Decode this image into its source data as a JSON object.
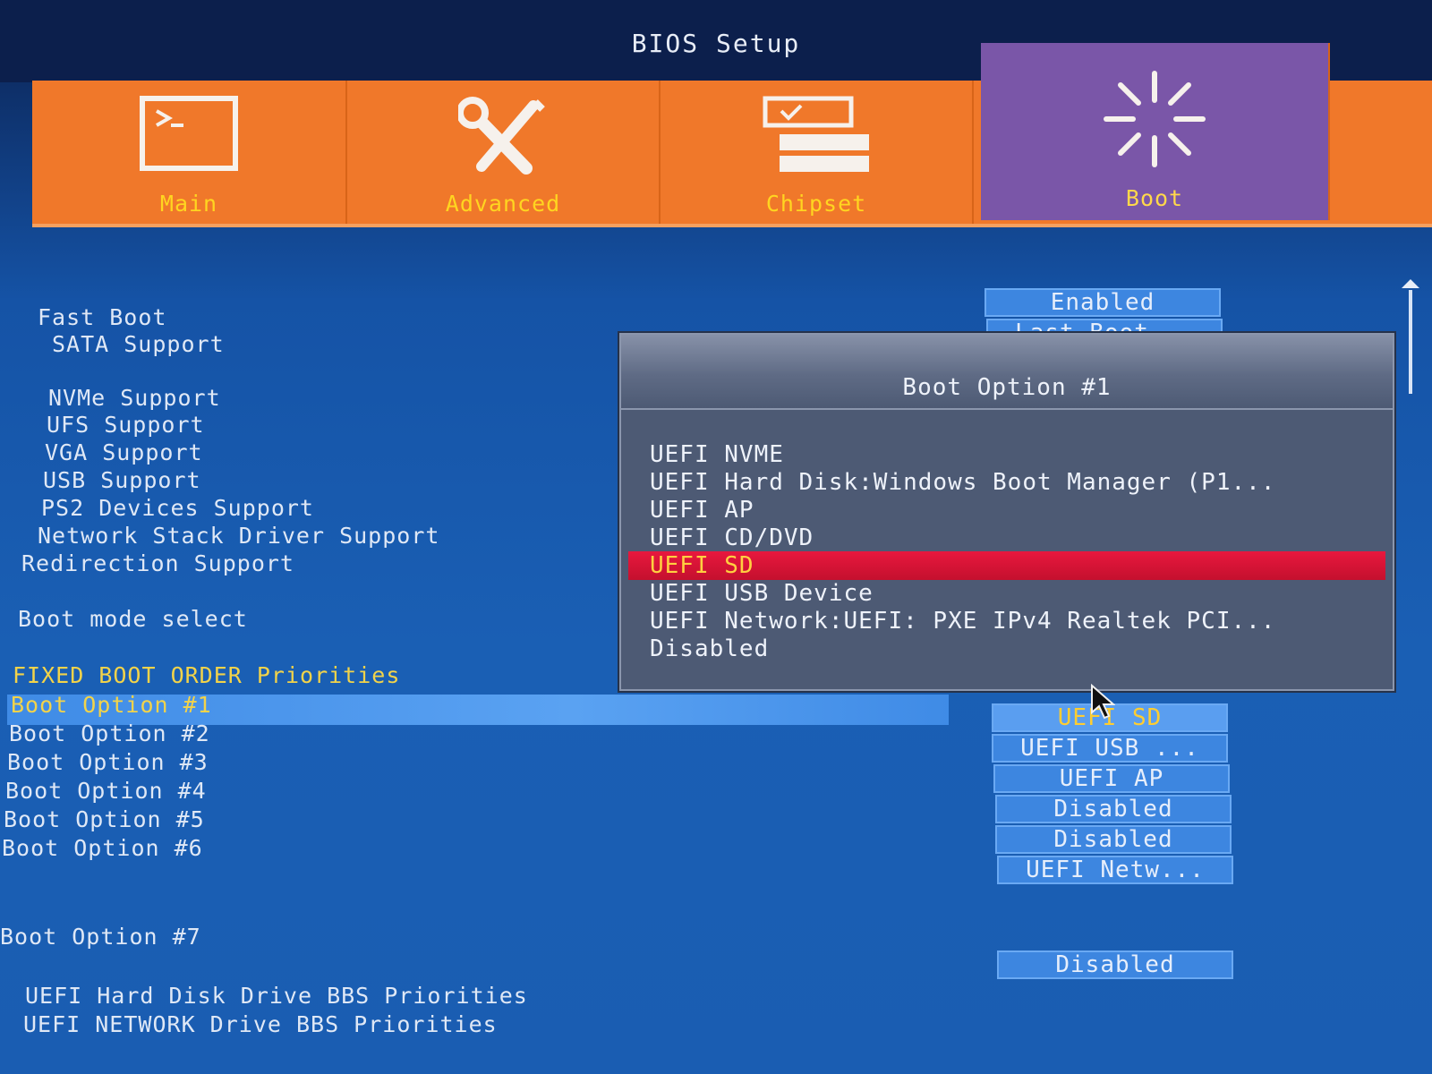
{
  "title": "BIOS Setup",
  "tabs": [
    {
      "label": "Main",
      "icon": "terminal-icon",
      "active": false
    },
    {
      "label": "Advanced",
      "icon": "wrench-screwdriver-icon",
      "active": false
    },
    {
      "label": "Chipset",
      "icon": "chipset-checklist-icon",
      "active": false
    },
    {
      "label": "Boot",
      "icon": "power-burst-icon",
      "active": true
    }
  ],
  "settings": {
    "fast_boot": {
      "label": "Fast Boot",
      "value": "Enabled"
    },
    "sata_support": {
      "label": "SATA Support",
      "value": "Last Boot..."
    },
    "nvme_support": "NVMe Support",
    "ufs_support": "UFS Support",
    "vga_support": "VGA Support",
    "usb_support": "USB Support",
    "ps2_support": "PS2 Devices Support",
    "network_stack": "Network Stack Driver Support",
    "redirection": "Redirection Support",
    "boot_mode": "Boot mode select",
    "section_header": "FIXED BOOT ORDER Priorities",
    "boot_options": [
      {
        "label": "Boot Option #1",
        "value": "UEFI SD"
      },
      {
        "label": "Boot Option #2",
        "value": "UEFI USB ..."
      },
      {
        "label": "Boot Option #3",
        "value": "UEFI AP"
      },
      {
        "label": "Boot Option #4",
        "value": "Disabled"
      },
      {
        "label": "Boot Option #5",
        "value": "Disabled"
      },
      {
        "label": "Boot Option #6",
        "value": "UEFI Netw..."
      },
      {
        "label": "Boot Option #7",
        "value": "Disabled"
      }
    ],
    "hdd_bbs": "UEFI Hard Disk Drive BBS Priorities",
    "net_bbs": "UEFI NETWORK Drive BBS Priorities"
  },
  "popup": {
    "title": "Boot Option #1",
    "options": [
      "UEFI NVME",
      "UEFI Hard Disk:Windows Boot Manager (P1...",
      "UEFI AP",
      "UEFI CD/DVD",
      "UEFI SD",
      "UEFI USB Device",
      "UEFI Network:UEFI: PXE IPv4 Realtek PCI...",
      "Disabled"
    ],
    "selected": "UEFI SD"
  },
  "colors": {
    "background": "#1a5db2",
    "tab_bar": "#f0782a",
    "active_tab": "#7a56a8",
    "highlight_text": "#f2d34a",
    "popup_selection": "#e8183e"
  }
}
